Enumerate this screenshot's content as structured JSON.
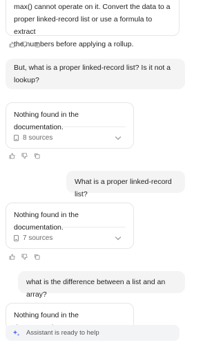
{
  "messages": [
    {
      "role": "assistant",
      "lines": [
        "max() cannot operate on it. Convert the data to a",
        "proper linked-record list or use a formula to extract",
        "the numbers before applying a rollup."
      ]
    },
    {
      "role": "user",
      "lines": [
        "But, what is a proper linked-record list? Is it not a",
        "lookup?"
      ]
    },
    {
      "role": "assistant",
      "text": "Nothing found in the documentation.",
      "sources_label": "8 sources"
    },
    {
      "role": "user",
      "text": "What is a proper linked-record list?"
    },
    {
      "role": "assistant",
      "text": "Nothing found in the documentation.",
      "sources_label": "7 sources"
    },
    {
      "role": "user",
      "text": "what is the difference between a list and an array?"
    },
    {
      "role": "assistant",
      "text": "Nothing found in the documentation."
    }
  ],
  "action_icons": [
    "thumbs-up-icon",
    "thumbs-down-icon",
    "copy-icon"
  ],
  "footer": {
    "status": "Assistant is ready to help"
  },
  "colors": {
    "card_border": "#e6e6e6",
    "user_bubble": "#f4f4f4",
    "footer_bg": "#f3f4f6",
    "accent": "#5b6cf0"
  }
}
